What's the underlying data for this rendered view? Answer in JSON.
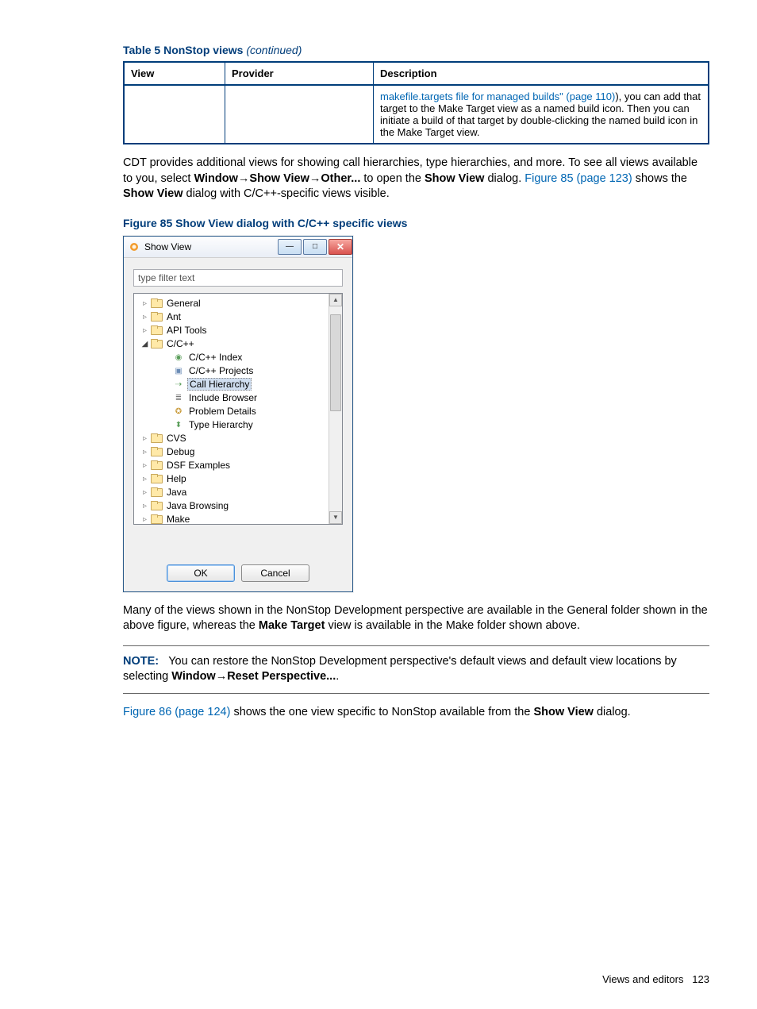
{
  "table": {
    "caption_strong": "Table 5 NonStop views",
    "caption_cont": "(continued)",
    "headers": {
      "view": "View",
      "provider": "Provider",
      "description": "Description"
    },
    "row": {
      "view": "",
      "provider": "",
      "desc_link": "makefile.targets file for managed builds\" (page 110)",
      "desc_after": "), you can add that target to the Make Target view as a named build icon. Then you can initiate a build of that target by double-clicking the named build icon in the Make Target view."
    }
  },
  "para1_pre": "CDT provides additional views for showing call hierarchies, type hierarchies, and more. To see all views available to you, select ",
  "para1_b1": "Window",
  "para1_b2": "Show View",
  "para1_b3": "Other...",
  "para1_mid": " to open the ",
  "para1_b4": "Show View",
  "para1_post": " dialog. ",
  "para1_link": "Figure 85 (page 123)",
  "para1_after_link": " shows the ",
  "para1_b5": "Show View",
  "para1_tail": " dialog with C/C++-specific views visible.",
  "fig85_caption": "Figure 85 Show View dialog with C/C++ specific views",
  "dialog": {
    "title": "Show View",
    "filter_placeholder": "type filter text",
    "tree": {
      "general": "General",
      "ant": "Ant",
      "apitools": "API Tools",
      "ccpp": "C/C++",
      "ccpp_children": {
        "index": "C/C++ Index",
        "projects": "C/C++ Projects",
        "callh": "Call Hierarchy",
        "incb": "Include Browser",
        "probd": "Problem Details",
        "typeh": "Type Hierarchy"
      },
      "cvs": "CVS",
      "debug": "Debug",
      "dsf": "DSF Examples",
      "help": "Help",
      "java": "Java",
      "javab": "Java Browsing",
      "make": "Make"
    },
    "ok": "OK",
    "cancel": "Cancel"
  },
  "para2_pre": "Many of the views shown in the NonStop Development perspective are available in the General folder shown in the above figure, whereas the ",
  "para2_b1": "Make Target",
  "para2_post": " view is available in the Make folder shown above.",
  "note": {
    "label": "NOTE:",
    "pre": "You can restore the NonStop Development perspective's default views and default view locations by selecting ",
    "b1": "Window",
    "b2": "Reset Perspective...",
    "tail": "."
  },
  "para3_link": "Figure 86 (page 124)",
  "para3_mid": " shows the one view specific to NonStop available from the ",
  "para3_b1": "Show View",
  "para3_tail": " dialog.",
  "footer_text": "Views and editors",
  "footer_page": "123"
}
